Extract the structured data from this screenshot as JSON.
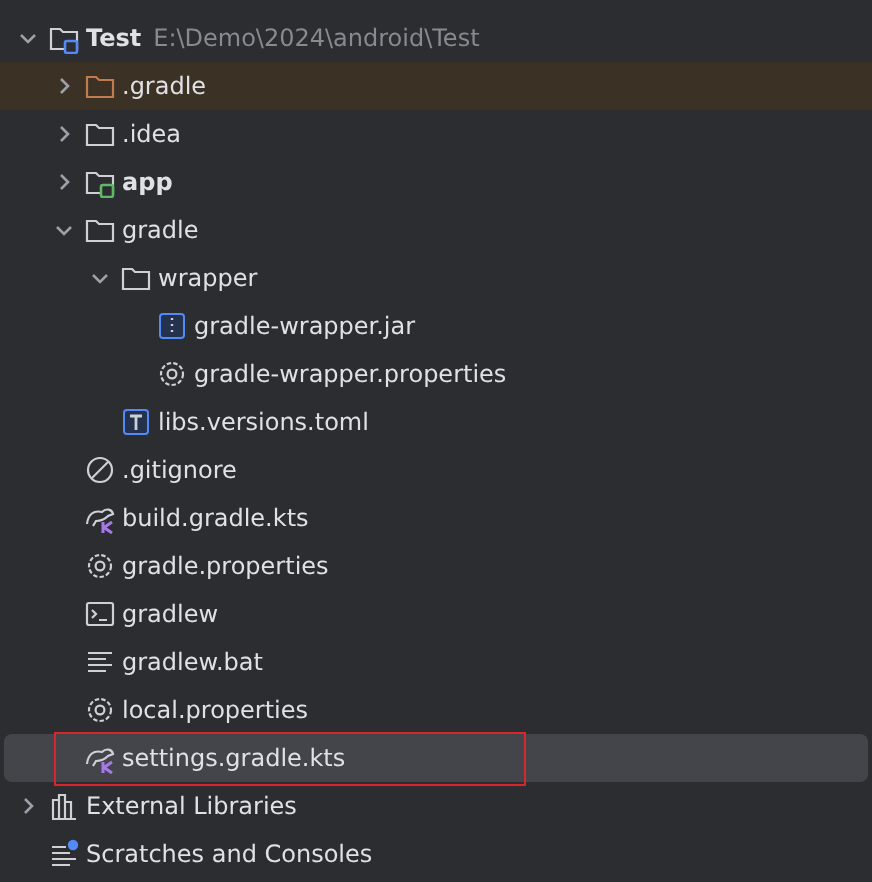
{
  "project_tree": [
    {
      "name": "Test",
      "path": "E:\\Demo\\2024\\android\\Test",
      "kind": "project",
      "expanded": true,
      "selected": false,
      "outlined": false,
      "children": [
        {
          "name": ".gradle",
          "kind": "excluded-folder",
          "expanded": false,
          "selected": false,
          "outlined": false
        },
        {
          "name": ".idea",
          "kind": "folder",
          "expanded": false,
          "selected": false,
          "outlined": false
        },
        {
          "name": "app",
          "kind": "module",
          "expanded": false,
          "selected": false,
          "outlined": false
        },
        {
          "name": "gradle",
          "kind": "folder",
          "expanded": true,
          "selected": false,
          "outlined": false,
          "children": [
            {
              "name": "wrapper",
              "kind": "folder",
              "expanded": true,
              "selected": false,
              "outlined": false,
              "children": [
                {
                  "name": "gradle-wrapper.jar",
                  "kind": "jar",
                  "selected": false,
                  "outlined": false
                },
                {
                  "name": "gradle-wrapper.properties",
                  "kind": "properties",
                  "selected": false,
                  "outlined": false
                }
              ]
            },
            {
              "name": "libs.versions.toml",
              "kind": "toml",
              "selected": false,
              "outlined": false
            }
          ]
        },
        {
          "name": ".gitignore",
          "kind": "ignore",
          "selected": false,
          "outlined": false
        },
        {
          "name": "build.gradle.kts",
          "kind": "gradle-script",
          "selected": false,
          "outlined": false
        },
        {
          "name": "gradle.properties",
          "kind": "properties",
          "selected": false,
          "outlined": false
        },
        {
          "name": "gradlew",
          "kind": "shell",
          "selected": false,
          "outlined": false
        },
        {
          "name": "gradlew.bat",
          "kind": "text",
          "selected": false,
          "outlined": false
        },
        {
          "name": "local.properties",
          "kind": "properties",
          "selected": false,
          "outlined": false
        },
        {
          "name": "settings.gradle.kts",
          "kind": "gradle-script",
          "selected": true,
          "outlined": true
        }
      ]
    },
    {
      "name": "External Libraries",
      "kind": "libraries",
      "expanded": false,
      "selected": false,
      "outlined": false
    },
    {
      "name": "Scratches and Consoles",
      "kind": "scratches",
      "selected": false,
      "outlined": false
    }
  ]
}
